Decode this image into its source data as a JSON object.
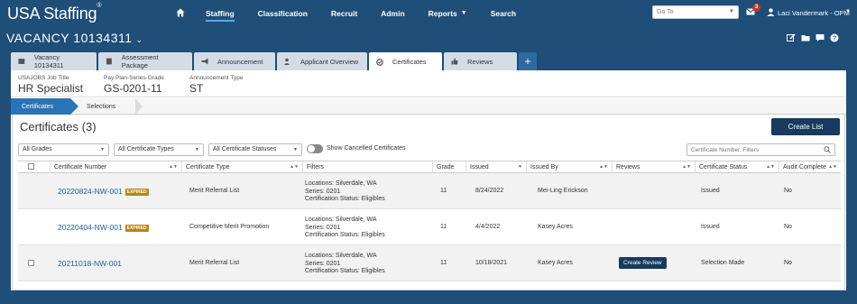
{
  "app": {
    "logo": "USA Staffing",
    "logo_mark": "®"
  },
  "nav": {
    "items": [
      {
        "label": "Staffing"
      },
      {
        "label": "Classification"
      },
      {
        "label": "Recruit"
      },
      {
        "label": "Admin"
      },
      {
        "label": "Reports"
      },
      {
        "label": "Search"
      }
    ],
    "goto_placeholder": "Go To",
    "mail_count": "3",
    "user_name": "Laci Vandermark - OPM"
  },
  "vacancy": {
    "title": "VACANCY 10134311"
  },
  "tabs": [
    {
      "label": "Vacancy 10134311"
    },
    {
      "label": "Assessment Package"
    },
    {
      "label": "Announcement"
    },
    {
      "label": "Applicant Overview"
    },
    {
      "label": "Certificates"
    },
    {
      "label": "Reviews"
    },
    {
      "label": "+"
    }
  ],
  "summary": {
    "job_title_label": "USAJOBS Job Title",
    "job_title": "HR Specialist",
    "ppsg_label": "Pay Plan-Series-Grade",
    "ppsg": "GS-0201-11",
    "ann_type_label": "Announcement Type",
    "ann_type": "ST"
  },
  "steps": {
    "active": "Certificates",
    "next": "Selections"
  },
  "certificates": {
    "title": "Certificates (3)",
    "create_label": "Create List",
    "filters": {
      "grades": "All Grades",
      "types": "All Certificate Types",
      "statuses": "All Certificate Statuses",
      "toggle_label": "Show Cancelled Certificates",
      "search_placeholder": "Certificate Number, Filters"
    },
    "columns": [
      "Certificate Number",
      "Certificate Type",
      "Filters",
      "Grade",
      "Issued",
      "Issued By",
      "Reviews",
      "Certificate Status",
      "Audit Complete"
    ],
    "expired_label": "EXPIRED",
    "rows": [
      {
        "number": "20220824-NW-001",
        "expired": true,
        "type": "Merit Referral List",
        "f1": "Locations: Silverdale, WA",
        "f2": "Series: 0201",
        "f3": "Certification Status: Eligibles",
        "grade": "11",
        "issued": "8/24/2022",
        "issued_by": "Mei-Ling Erickson",
        "review": "",
        "status": "Issued",
        "audit": "No"
      },
      {
        "number": "20220404-NW-001",
        "expired": true,
        "type": "Competitive Merit Promotion",
        "f1": "Locations: Silverdale, WA",
        "f2": "Series: 0201",
        "f3": "Certification Status: Eligibles",
        "grade": "11",
        "issued": "4/4/2022",
        "issued_by": "Kasey Acres",
        "review": "",
        "status": "Issued",
        "audit": "No"
      },
      {
        "number": "20211018-NW-001",
        "expired": false,
        "type": "Merit Referral List",
        "f1": "Locations: Silverdale, WA",
        "f2": "Series: 0201",
        "f3": "Certification Status: Eligibles",
        "grade": "11",
        "issued": "10/18/2021",
        "issued_by": "Kasey Acres",
        "review": "Create Review",
        "status": "Selection Made",
        "audit": "No"
      }
    ]
  },
  "colors": {
    "brand": "#1f4e79",
    "accent": "#2a74b5",
    "button": "#173a5e",
    "expired": "#b8860b"
  }
}
